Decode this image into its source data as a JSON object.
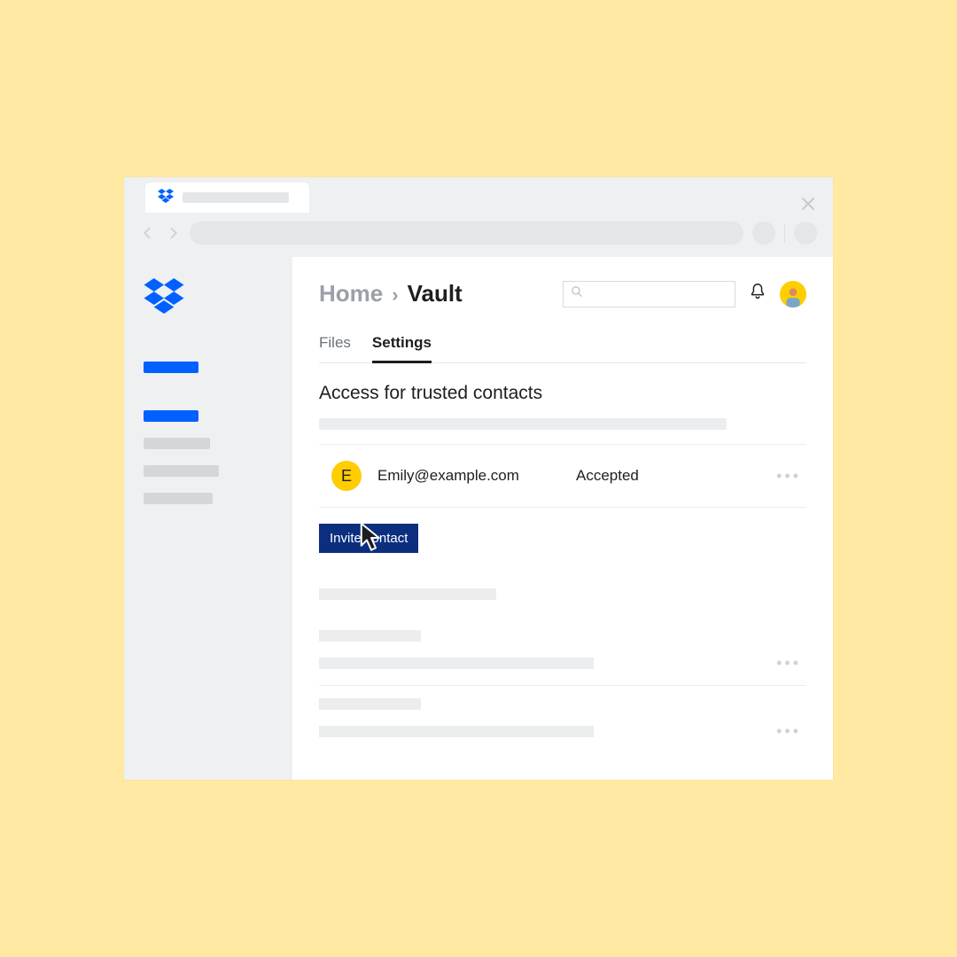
{
  "breadcrumb": {
    "home": "Home",
    "sep": "›",
    "current": "Vault"
  },
  "tabs": {
    "files": "Files",
    "settings": "Settings"
  },
  "section": {
    "title": "Access for trusted contacts"
  },
  "contact": {
    "initial": "E",
    "email": "Emily@example.com",
    "status": "Accepted"
  },
  "actions": {
    "invite": "Invite contact"
  },
  "colors": {
    "brand": "#0061ff",
    "accentYellow": "#ffcd00",
    "inviteBg": "#0b2e7f"
  }
}
